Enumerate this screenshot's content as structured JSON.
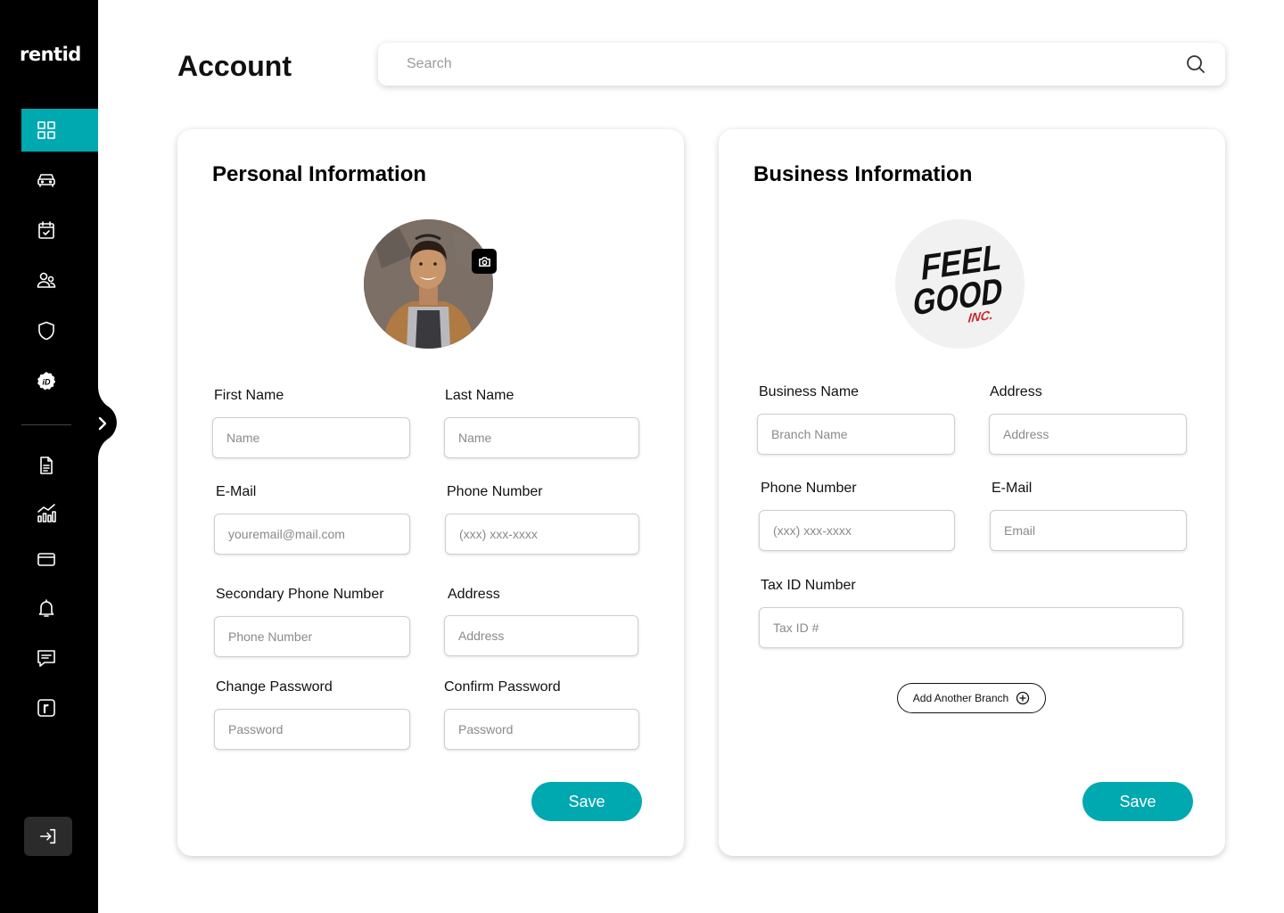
{
  "app": {
    "logo_text": "rentid"
  },
  "sidebar": {
    "items": [
      {
        "icon": "grid-icon",
        "active": true
      },
      {
        "icon": "car-icon",
        "active": false
      },
      {
        "icon": "calendar-check-icon",
        "active": false
      },
      {
        "icon": "users-icon",
        "active": false
      },
      {
        "icon": "shield-icon",
        "active": false
      },
      {
        "icon": "id-badge-icon",
        "active": false
      },
      {
        "icon": "document-icon",
        "active": false
      },
      {
        "icon": "analytics-icon",
        "active": false
      },
      {
        "icon": "wallet-icon",
        "active": false
      },
      {
        "icon": "bell-icon",
        "active": false
      },
      {
        "icon": "message-icon",
        "active": false
      },
      {
        "icon": "rentid-r-icon",
        "active": false
      }
    ],
    "collapse_icon": "chevron-right-icon",
    "logout_icon": "logout-icon"
  },
  "header": {
    "title": "Account",
    "search_placeholder": "Search"
  },
  "personal": {
    "title": "Personal Information",
    "first_name_label": "First Name",
    "first_name_placeholder": "Name",
    "last_name_label": "Last Name",
    "last_name_placeholder": "Name",
    "email_label": "E-Mail",
    "email_placeholder": "youremail@mail.com",
    "phone_label": "Phone Number",
    "phone_placeholder": "(xxx) xxx-xxxx",
    "secondary_phone_label": "Secondary Phone Number",
    "secondary_phone_placeholder": "Phone Number",
    "address_label": "Address",
    "address_placeholder": "Address",
    "change_password_label": "Change Password",
    "change_password_placeholder": "Password",
    "confirm_password_label": "Confirm Password",
    "confirm_password_placeholder": "Password",
    "save_label": "Save"
  },
  "business": {
    "title": "Business Information",
    "logo_text": [
      "FEEL",
      "GOOD",
      "INC."
    ],
    "business_name_label": "Business Name",
    "business_name_placeholder": "Branch Name",
    "address_label": "Address",
    "address_placeholder": "Address",
    "phone_label": "Phone Number",
    "phone_placeholder": "(xxx) xxx-xxxx",
    "email_label": "E-Mail",
    "email_placeholder": "Email",
    "tax_id_label": "Tax ID Number",
    "tax_id_placeholder": "Tax ID #",
    "add_branch_label": "Add Another Branch",
    "save_label": "Save"
  },
  "colors": {
    "accent": "#00a8b0",
    "sidebar_bg": "#000000",
    "logo_red": "#c8282d"
  }
}
